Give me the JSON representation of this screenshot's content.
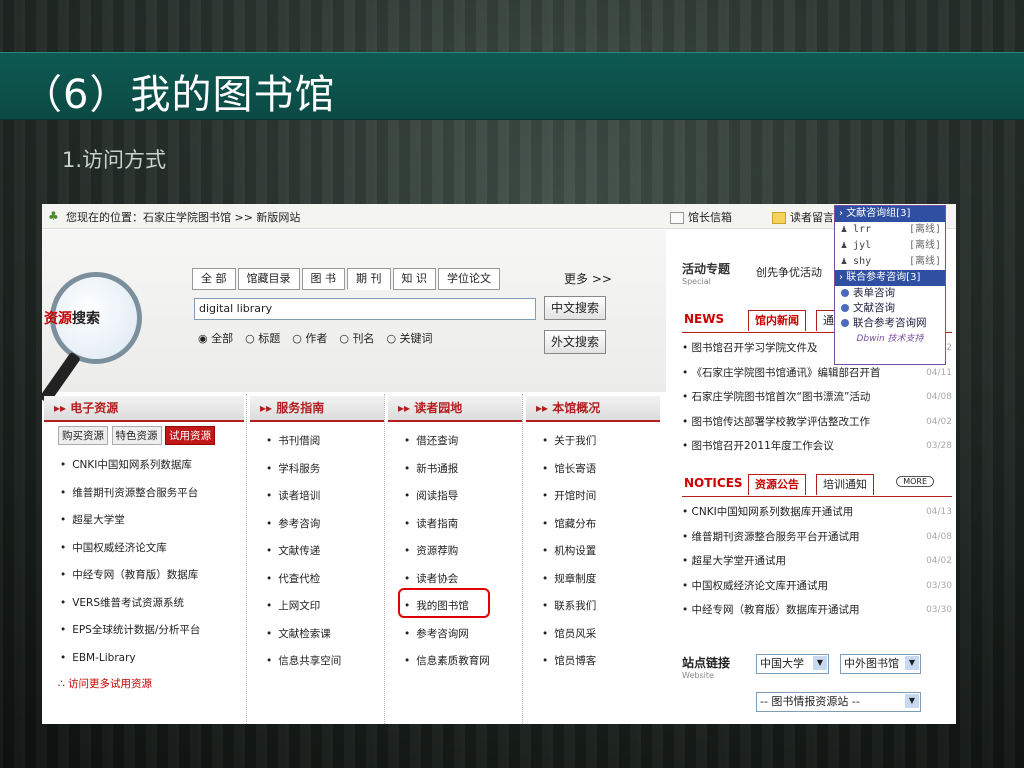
{
  "slide": {
    "title": "（6）我的图书馆",
    "subtitle": "1.访问方式"
  },
  "topbar": {
    "location": "您现在的位置：石家庄学院图书馆 >> 新版网站",
    "mailbox": "馆长信箱",
    "guestbook": "读者留言"
  },
  "search": {
    "logo_red": "资源",
    "logo_black": "搜索",
    "tabs": [
      "全 部",
      "馆藏目录",
      "图 书",
      "期 刊",
      "知 识",
      "学位论文"
    ],
    "more": "更多 >>",
    "query": "digital library",
    "btn_cn": "中文搜索",
    "btn_foreign": "外文搜索",
    "radios": [
      "全部",
      "标题",
      "作者",
      "刊名",
      "关键词"
    ]
  },
  "columns": [
    {
      "title": "电子资源"
    },
    {
      "title": "服务指南",
      "items": [
        "书刊借阅",
        "学科服务",
        "读者培训",
        "参考咨询",
        "文献传递",
        "代查代检",
        "上网文印",
        "文献检索课",
        "信息共享空间"
      ]
    },
    {
      "title": "读者园地",
      "items": [
        "借还查询",
        "新书通报",
        "阅读指导",
        "读者指南",
        "资源荐购",
        "读者协会",
        "我的图书馆",
        "参考咨询网",
        "信息素质教育网"
      ]
    },
    {
      "title": "本馆概况",
      "items": [
        "关于我们",
        "馆长寄语",
        "开馆时间",
        "馆藏分布",
        "机构设置",
        "规章制度",
        "联系我们",
        "馆员风采",
        "馆员博客"
      ]
    }
  ],
  "eresources": {
    "subtabs": [
      "购买资源",
      "特色资源",
      "试用资源"
    ],
    "items": [
      "CNKI中国知网系列数据库",
      "维普期刊资源整合服务平台",
      "超星大学堂",
      "中国权威经济论文库",
      "中经专网（教育版）数据库",
      "VERS维普考试资源系统",
      "EPS全球统计数据/分析平台",
      "EBM-Library"
    ],
    "more": "∴ 访问更多试用资源"
  },
  "events": {
    "title": "活动专题",
    "en": "Special",
    "text": "创先争优活动"
  },
  "news": {
    "label": "NEWS",
    "tabs": [
      "馆内新闻",
      "通知"
    ],
    "items": [
      {
        "text": "图书馆召开学习学院文件及",
        "date": "2"
      },
      {
        "text": "《石家庄学院图书馆通讯》编辑部召开首",
        "date": "04/11"
      },
      {
        "text": "石家庄学院图书馆首次“图书漂流”活动",
        "date": "04/08"
      },
      {
        "text": "图书馆传达部署学校教学评估整改工作",
        "date": "04/02"
      },
      {
        "text": "图书馆召开2011年度工作会议",
        "date": "03/28"
      }
    ]
  },
  "notices": {
    "label": "NOTICES",
    "tabs": [
      "资源公告",
      "培训通知"
    ],
    "more": "MORE",
    "items": [
      {
        "text": "CNKI中国知网系列数据库开通试用",
        "date": "04/13"
      },
      {
        "text": "维普期刊资源整合服务平台开通试用",
        "date": "04/08"
      },
      {
        "text": "超星大学堂开通试用",
        "date": "04/02"
      },
      {
        "text": "中国权威经济论文库开通试用",
        "date": "03/30"
      },
      {
        "text": "中经专网（教育版）数据库开通试用",
        "date": "03/30"
      }
    ]
  },
  "links": {
    "title": "站点链接",
    "en": "Website",
    "select1": "中国大学",
    "select2": "中外图书馆",
    "select3": "-- 图书情报资源站 --"
  },
  "consult": {
    "group1": "文献咨询组[3]",
    "users": [
      {
        "name": "lrr",
        "status": "[离线]"
      },
      {
        "name": "jyl",
        "status": "[离线]"
      },
      {
        "name": "shy",
        "status": "[离线]"
      }
    ],
    "group2": "联合参考咨询[3]",
    "links": [
      "表单咨询",
      "文献咨询",
      "联合参考咨询网"
    ],
    "footer": "Dbwin 技术支持"
  }
}
